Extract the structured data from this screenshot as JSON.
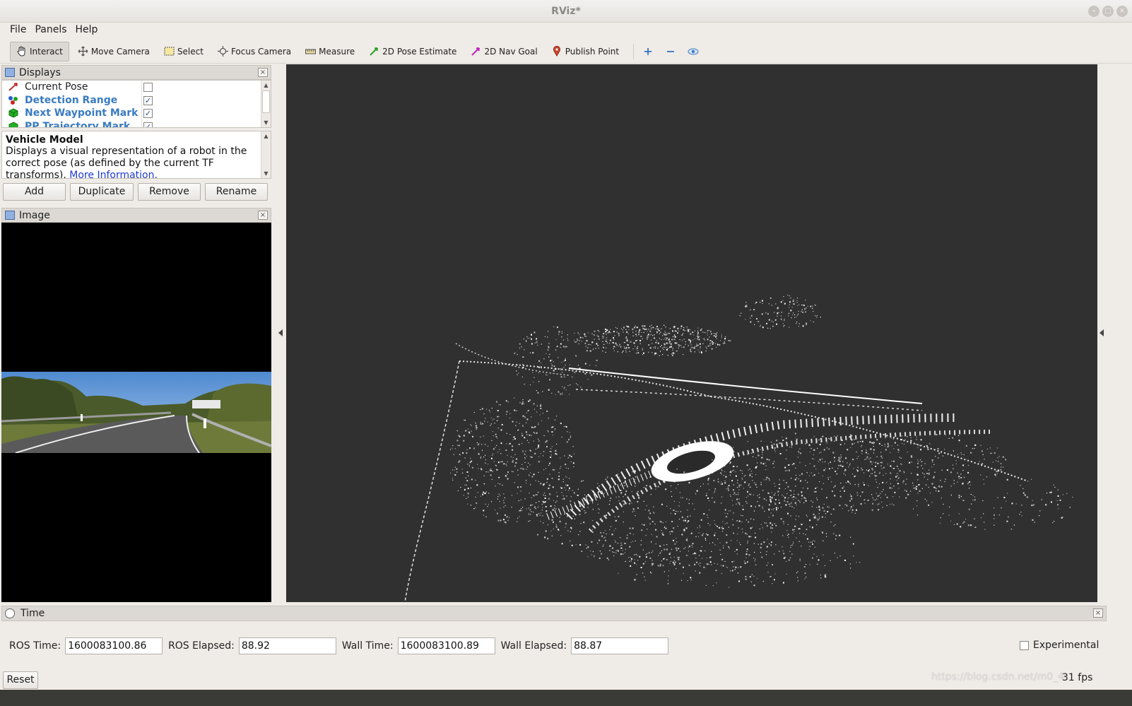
{
  "window": {
    "title": "RViz*"
  },
  "menubar": {
    "items": [
      {
        "label": "File"
      },
      {
        "label": "Panels"
      },
      {
        "label": "Help"
      }
    ]
  },
  "toolbar": {
    "tools": [
      {
        "label": "Interact",
        "icon": "hand-icon",
        "active": true
      },
      {
        "label": "Move Camera",
        "icon": "move-camera-icon"
      },
      {
        "label": "Select",
        "icon": "select-icon"
      },
      {
        "label": "Focus Camera",
        "icon": "focus-camera-icon"
      },
      {
        "label": "Measure",
        "icon": "measure-icon"
      },
      {
        "label": "2D Pose Estimate",
        "icon": "pose-estimate-icon"
      },
      {
        "label": "2D Nav Goal",
        "icon": "nav-goal-icon"
      },
      {
        "label": "Publish Point",
        "icon": "map-pin-icon"
      }
    ]
  },
  "displays_panel": {
    "title": "Displays",
    "items": [
      {
        "label": "Current Pose",
        "checked": false
      },
      {
        "label": "Detection Range",
        "checked": true
      },
      {
        "label": "Next Waypoint Mark",
        "checked": true
      },
      {
        "label": "PP Trajectory Mark",
        "checked": true
      }
    ],
    "description": {
      "title": "Vehicle Model",
      "text": "Displays a visual representation of a robot in the correct pose (as defined by the current TF transforms).",
      "link": "More Information."
    },
    "buttons": {
      "add": "Add",
      "duplicate": "Duplicate",
      "remove": "Remove",
      "rename": "Rename"
    }
  },
  "image_panel": {
    "title": "Image"
  },
  "time_panel": {
    "title": "Time",
    "ros_time_label": "ROS Time:",
    "ros_time": "1600083100.86",
    "ros_elapsed_label": "ROS Elapsed:",
    "ros_elapsed": "88.92",
    "wall_time_label": "Wall Time:",
    "wall_time": "1600083100.89",
    "wall_elapsed_label": "Wall Elapsed:",
    "wall_elapsed": "88.87",
    "experimental_label": "Experimental",
    "reset_label": "Reset",
    "fps": "31 fps"
  },
  "watermark": "https://blog.csdn.net/m0_4",
  "colors": {
    "render_bg": "#303030",
    "accent_blue": "#3a7bc0",
    "link": "#1d3ad0"
  }
}
